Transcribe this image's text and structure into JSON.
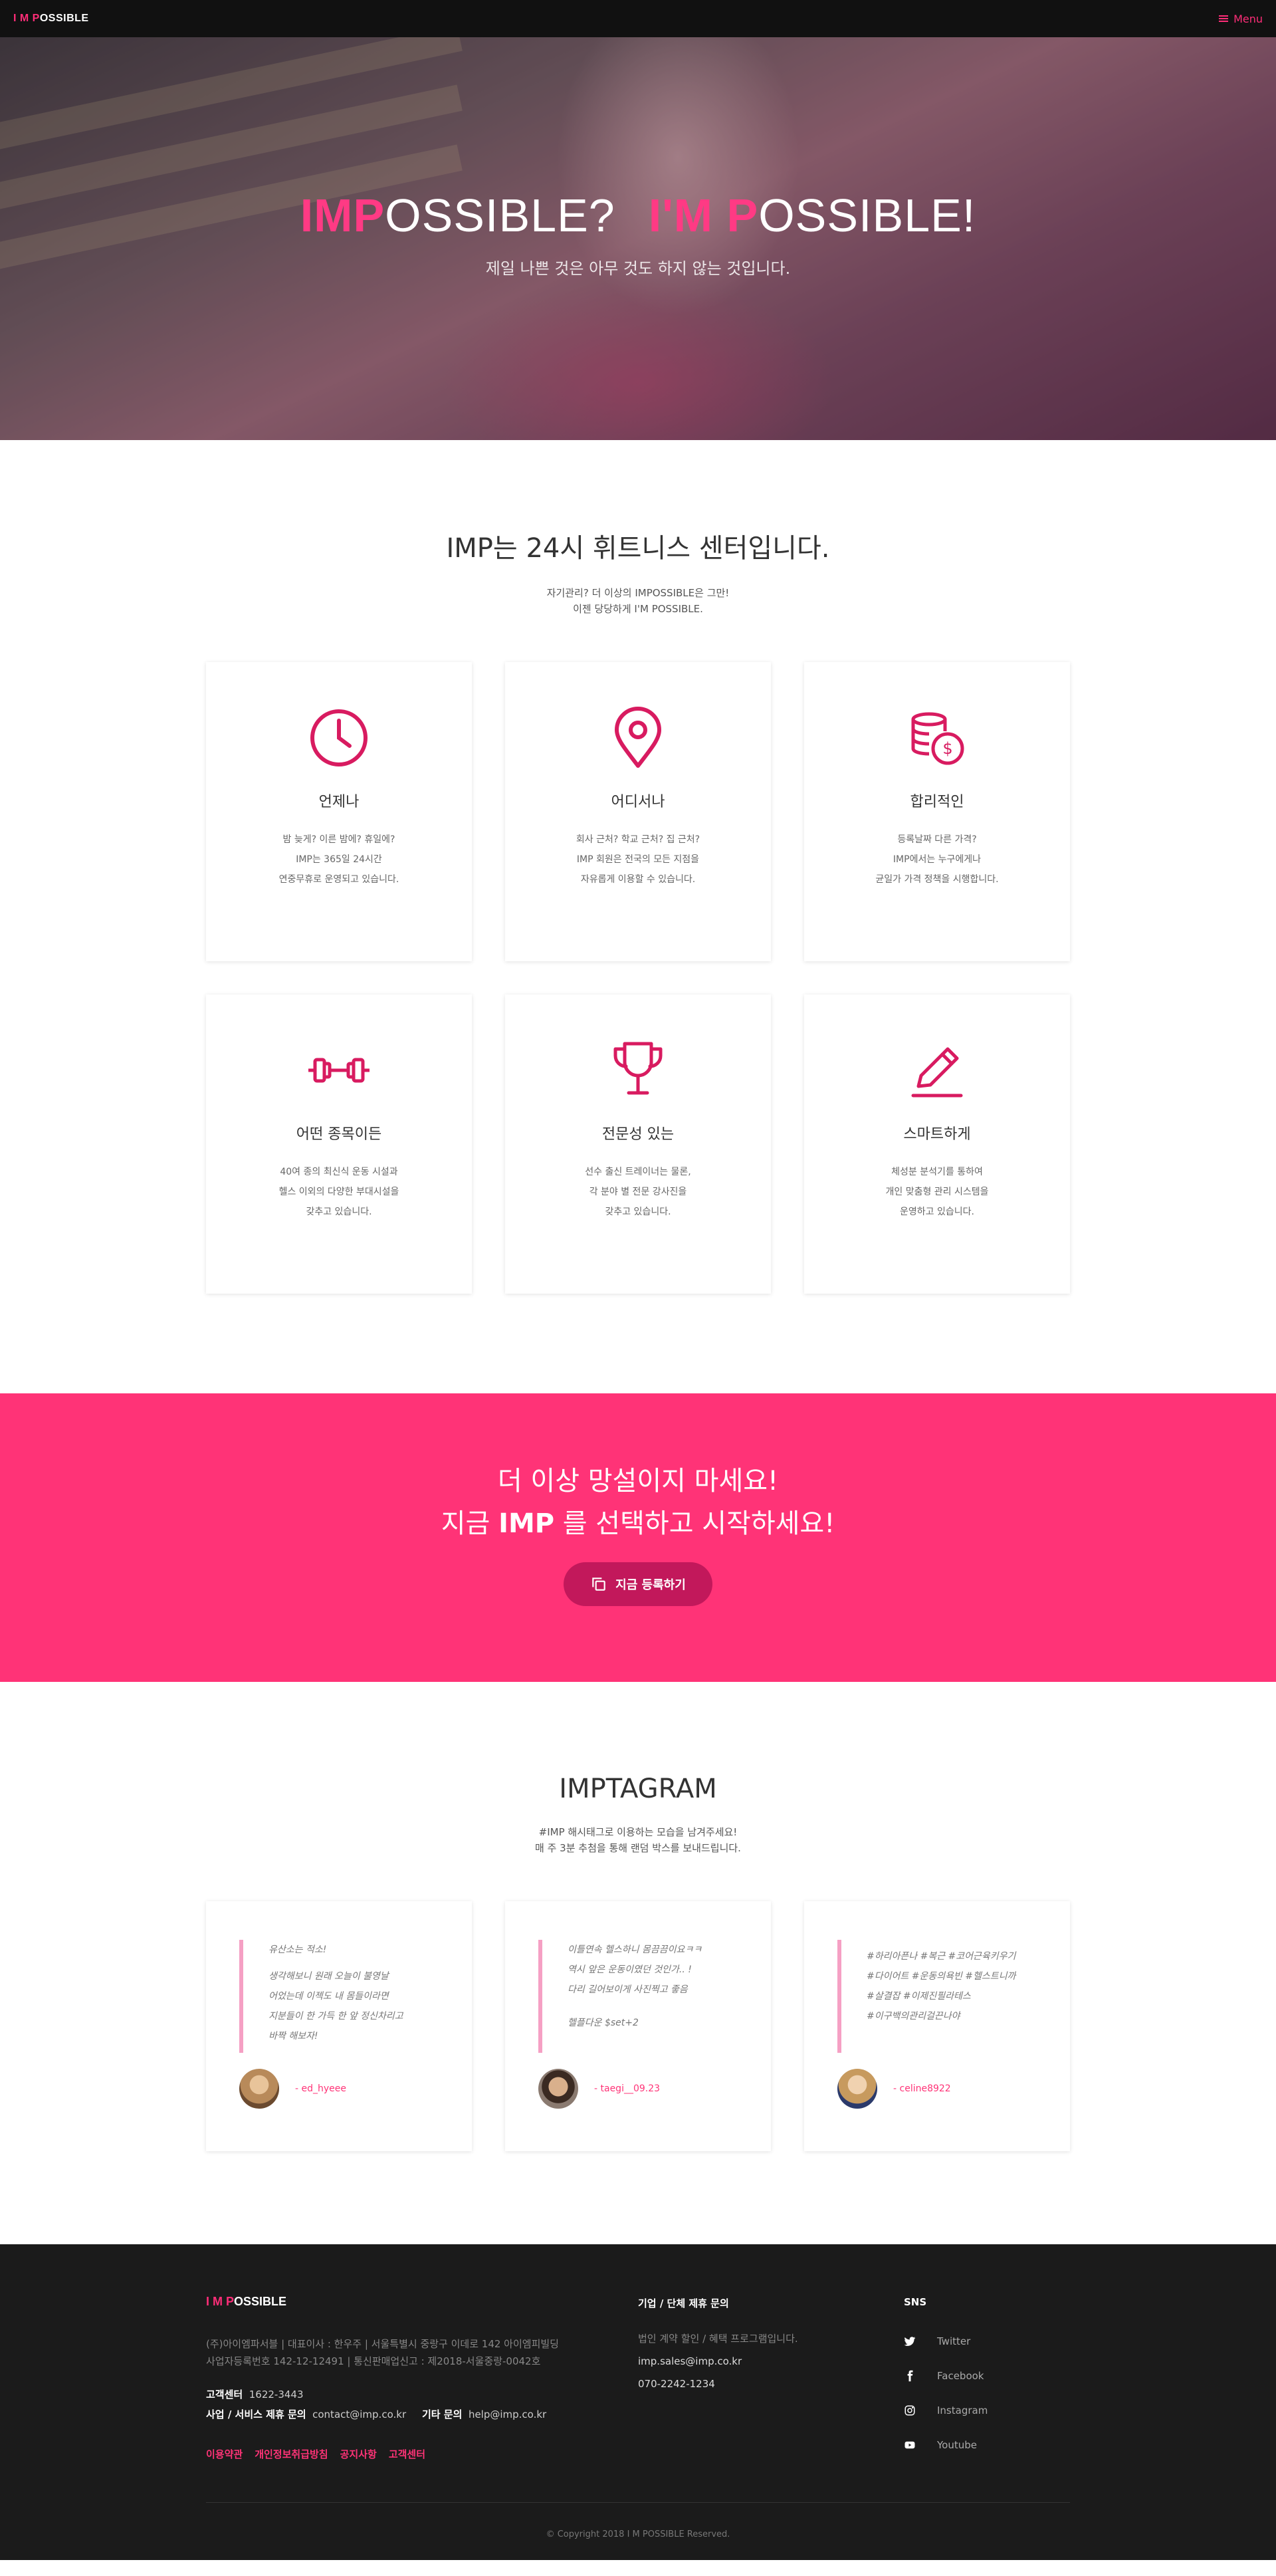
{
  "nav": {
    "logo_parts": [
      "I",
      " M ",
      "P",
      "OSSIBLE"
    ],
    "menu_label": "Menu"
  },
  "hero": {
    "title_a_bold": "IMP",
    "title_a_rest": "OSSIBLE?",
    "title_b_bold1": "I'M P",
    "title_b_rest": "OSSIBLE!",
    "subtitle": "제일 나쁜 것은 아무 것도 하지 않는 것입니다."
  },
  "about": {
    "title": "IMP는 24시 휘트니스 센터입니다.",
    "desc1": "자기관리? 더 이상의 IMPOSSIBLE은 그만!",
    "desc2": "이젠 당당하게 I'M POSSIBLE.",
    "cards": [
      {
        "icon": "clock-icon",
        "title": "언제나",
        "lines": [
          "밤 늦게? 이른 밤에? 휴일에?",
          "IMP는 365일 24시간",
          "연중무휴로 운영되고 있습니다."
        ]
      },
      {
        "icon": "location-pin-icon",
        "title": "어디서나",
        "lines": [
          "회사 근처? 학교 근처? 집 근처?",
          "IMP 회원은 전국의 모든 지점을",
          "자유롭게 이용할 수 있습니다."
        ]
      },
      {
        "icon": "coins-icon",
        "title": "합리적인",
        "lines": [
          "등록날짜 다른 가격?",
          "IMP에서는 누구에게나",
          "균일가 가격 정책을 시행합니다."
        ]
      },
      {
        "icon": "dumbbell-icon",
        "title": "어떤 종목이든",
        "lines": [
          "40여 종의 최신식 운동 시설과",
          "헬스 이외의 다양한 부대시설을",
          "갖추고 있습니다."
        ]
      },
      {
        "icon": "trophy-icon",
        "title": "전문성 있는",
        "lines": [
          "선수 출신 트레이너는 물론,",
          "각 분야 별 전문 강사진을",
          "갖추고 있습니다."
        ]
      },
      {
        "icon": "pencil-icon",
        "title": "스마트하게",
        "lines": [
          "체성분 분석기를 통하여",
          "개인 맞춤형 관리 시스템을",
          "운영하고 있습니다."
        ]
      }
    ]
  },
  "cta": {
    "line1": "더 이상 망설이지 마세요!",
    "line2_pre": "지금 ",
    "line2_bold": "IMP",
    "line2_post": " 를 선택하고 시작하세요!",
    "button_label": "지금 등록하기"
  },
  "insta": {
    "title": "IMPTAGRAM",
    "desc1": "#IMP 해시태그로 이용하는 모습을 남겨주세요!",
    "desc2": "매 주 3분 추첨을 통해 랜덤 박스를 보내드립니다.",
    "posts": [
      {
        "lines": [
          "유산소는 적소!",
          "",
          "생각해보니 원래 오늘이 불영날",
          "어었는데 이젝도 내 몸들이라면",
          "지분들이 한 가득 한 앞 정신차리고",
          "바짝 해보자!"
        ],
        "handle": "- ed_hyeee"
      },
      {
        "lines": [
          "이틀연속 헬스하니 몸끔끔이요ㅋㅋ",
          "역시 앞은 운동이였던 것인가.. !",
          "다리 길어보이게 사진찍고 좋음",
          "",
          "",
          "헬플다운 $set+2"
        ],
        "handle": "- taegi__09.23"
      },
      {
        "lines": [
          "",
          "#하리아픈나 #복근 #코어근육키우기",
          "#다이어트 #운동의욕빈 #헬스트니까",
          "#살결잡 #이제진필라테스",
          "#이구백의관리걸끈나야"
        ],
        "handle": "- celine8922"
      }
    ]
  },
  "footer": {
    "logo_parts": [
      "I",
      " M ",
      "P",
      "OSSIBLE"
    ],
    "info1": "(주)아이엠파서블  |  대표이사 : 한우주  |  서울특별시 중랑구 이데로 142 아이엠피빌딩",
    "info2": "사업자등록번호 142-12-12491  |  통신판매업신고 : 제2018-서울중랑-0042호",
    "cs_label": "고객센터",
    "cs_value": "1622-3443",
    "biz_label": "사업 / 서비스 제휴 문의",
    "biz_value": "contact@imp.co.kr",
    "etc_label": "기타 문의",
    "etc_value": "help@imp.co.kr",
    "links": [
      "이용약관",
      "개인정보취급방침",
      "공지사항",
      "고객센터"
    ],
    "corp_head": "기업 / 단체 제휴 문의",
    "corp_desc": "법인 계약 할인 / 혜택 프로그램입니다.",
    "corp_email": "imp.sales@imp.co.kr",
    "corp_phone": "070-2242-1234",
    "sns_head": "SNS",
    "sns": [
      {
        "icon": "twitter-icon",
        "label": "Twitter"
      },
      {
        "icon": "facebook-icon",
        "label": "Facebook"
      },
      {
        "icon": "instagram-icon",
        "label": "Instagram"
      },
      {
        "icon": "youtube-icon",
        "label": "Youtube"
      }
    ],
    "copyright": "© Copyright 2018 I M POSSIBLE Reserved."
  },
  "colors": {
    "accent": "#ff3377",
    "dark": "#1b1b1b",
    "nav": "#111111",
    "button": "#c2185b"
  }
}
